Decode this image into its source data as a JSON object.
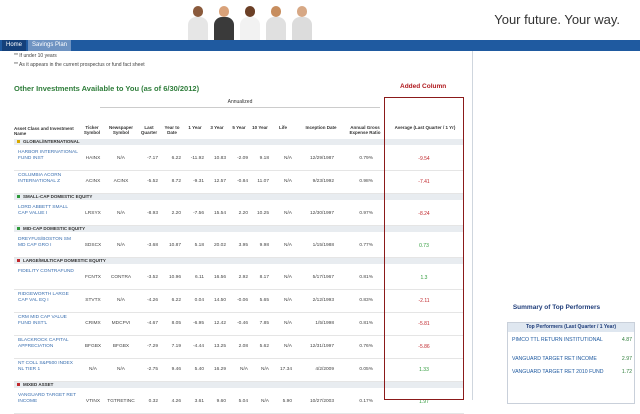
{
  "header": {
    "tagline": "Your future. Your way."
  },
  "nav": {
    "tabs": [
      "Home",
      "Savings Plan"
    ]
  },
  "notes": [
    "** If under 10 years",
    "** As it appears in the current prospectus or fund fact sheet"
  ],
  "section": {
    "title": "Other Investments Available to You (as of 6/30/2012)",
    "added_column": "Added Column",
    "annualized": "Annualized"
  },
  "columns": [
    "Asset Class and Investment Name",
    "Ticker Symbol",
    "Newspaper Symbol",
    "Last Quarter",
    "Year to Date",
    "1 Year",
    "3 Year",
    "5 Year",
    "10 Year",
    "Life",
    "Inception Date",
    "Annual Gross Expense Ratio",
    "Average (Last Quarter / 1 Yr)"
  ],
  "rows": [
    {
      "type": "cat",
      "label": "GLOBAL/INTERNATIONAL",
      "color": "#d8a800"
    },
    {
      "type": "fund",
      "name": "HARBOR INTERNATIONAL FUND INST",
      "ticker": "HAINX",
      "news": "N/A",
      "lq": "-7.17",
      "ytd": "6.22",
      "y1": "-11.92",
      "y3": "10.83",
      "y5": "-2.09",
      "y10": "9.18",
      "life": "N/A",
      "inc": "12/29/1987",
      "exp": "0.79%",
      "avg": "-9.54",
      "neg": true
    },
    {
      "type": "fund",
      "name": "COLUMBIA ACORN INTERNATIONAL Z",
      "ticker": "ACINX",
      "news": "ACINX",
      "lq": "-5.52",
      "ytd": "8.72",
      "y1": "-9.31",
      "y3": "12.57",
      "y5": "-0.84",
      "y10": "11.07",
      "life": "N/A",
      "inc": "9/23/1992",
      "exp": "0.98%",
      "avg": "-7.41",
      "neg": true
    },
    {
      "type": "cat",
      "label": "SMALL-CAP DOMESTIC EQUITY",
      "color": "#2e9a3a"
    },
    {
      "type": "fund",
      "name": "LORD ABBETT SMALL CAP VALUE I",
      "ticker": "LRSYX",
      "news": "N/A",
      "lq": "-8.93",
      "ytd": "2.20",
      "y1": "-7.56",
      "y3": "15.54",
      "y5": "2.20",
      "y10": "10.25",
      "life": "N/A",
      "inc": "12/30/1997",
      "exp": "0.97%",
      "avg": "-8.24",
      "neg": true
    },
    {
      "type": "cat",
      "label": "MID-CAP DOMESTIC EQUITY",
      "color": "#2e9a3a"
    },
    {
      "type": "fund",
      "name": "DREYFUS/BOSTON SM MD CAP GRO I",
      "ticker": "SDSCX",
      "news": "N/A",
      "lq": "-3.68",
      "ytd": "10.87",
      "y1": "5.18",
      "y3": "20.02",
      "y5": "3.95",
      "y10": "9.98",
      "life": "N/A",
      "inc": "1/15/1988",
      "exp": "0.77%",
      "avg": "0.73",
      "neg": false
    },
    {
      "type": "cat",
      "label": "LARGE/MULTICAP DOMESTIC EQUITY",
      "color": "#c0282d"
    },
    {
      "type": "fund",
      "name": "FIDELITY CONTRAFUND",
      "ticker": "FCNTX",
      "news": "CONTRA",
      "lq": "-3.52",
      "ytd": "10.96",
      "y1": "6.11",
      "y3": "16.56",
      "y5": "2.92",
      "y10": "8.17",
      "life": "N/A",
      "inc": "5/17/1967",
      "exp": "0.81%",
      "avg": "1.3",
      "neg": false
    },
    {
      "type": "fund",
      "name": "RIDGEWORTH LARGE CAP VAL EQ I",
      "ticker": "STVTX",
      "news": "N/A",
      "lq": "-4.26",
      "ytd": "6.22",
      "y1": "0.04",
      "y3": "14.50",
      "y5": "-0.06",
      "y10": "5.65",
      "life": "N/A",
      "inc": "2/12/1993",
      "exp": "0.83%",
      "avg": "-2.11",
      "neg": true
    },
    {
      "type": "fund",
      "name": "CRM MID CAP VALUE FUND INST'L",
      "ticker": "CRIMX",
      "news": "MDCPVI",
      "lq": "-4.67",
      "ytd": "8.05",
      "y1": "-6.95",
      "y3": "12.42",
      "y5": "-0.46",
      "y10": "7.85",
      "life": "N/A",
      "inc": "1/5/1998",
      "exp": "0.81%",
      "avg": "-5.81",
      "neg": true
    },
    {
      "type": "fund",
      "name": "BLACKROCK CAPITAL APPRECIATION",
      "ticker": "BFGBX",
      "news": "BFGBX",
      "lq": "-7.29",
      "ytd": "7.19",
      "y1": "-4.44",
      "y3": "13.25",
      "y5": "2.08",
      "y10": "5.62",
      "life": "N/A",
      "inc": "12/31/1997",
      "exp": "0.76%",
      "avg": "-5.86",
      "neg": true
    },
    {
      "type": "fund",
      "name": "NT COLL S&P500 INDEX NL TIER 1",
      "ticker": "N/A",
      "news": "N/A",
      "lq": "-2.75",
      "ytd": "9.46",
      "y1": "5.40",
      "y3": "16.29",
      "y5": "N/A",
      "y10": "N/A",
      "life": "17.34",
      "inc": "4/2/2009",
      "exp": "0.05%",
      "avg": "1.33",
      "neg": false
    },
    {
      "type": "cat",
      "label": "MIXED ASSET",
      "color": "#c0282d"
    },
    {
      "type": "fund",
      "name": "VANGUARD TARGET RET INCOME",
      "ticker": "VTINX",
      "news": "TGTRETINC",
      "lq": "0.32",
      "ytd": "4.26",
      "y1": "3.61",
      "y3": "9.60",
      "y5": "5.04",
      "y10": "N/A",
      "life": "5.90",
      "inc": "10/27/2003",
      "exp": "0.17%",
      "avg": "1.97",
      "neg": false
    }
  ],
  "summary": {
    "title": "Summary of Top Performers",
    "header": "Top Performers (Last Quarter / 1 Year)",
    "items": [
      {
        "name": "PIMCO TTL RETURN INSTITUTIONAL",
        "value": "4.87"
      },
      {
        "name": "VANGUARD TARGET RET INCOME",
        "value": "2.97"
      },
      {
        "name": "VANGUARD TARGET RET 2010 FUND",
        "value": "1.72"
      }
    ]
  }
}
